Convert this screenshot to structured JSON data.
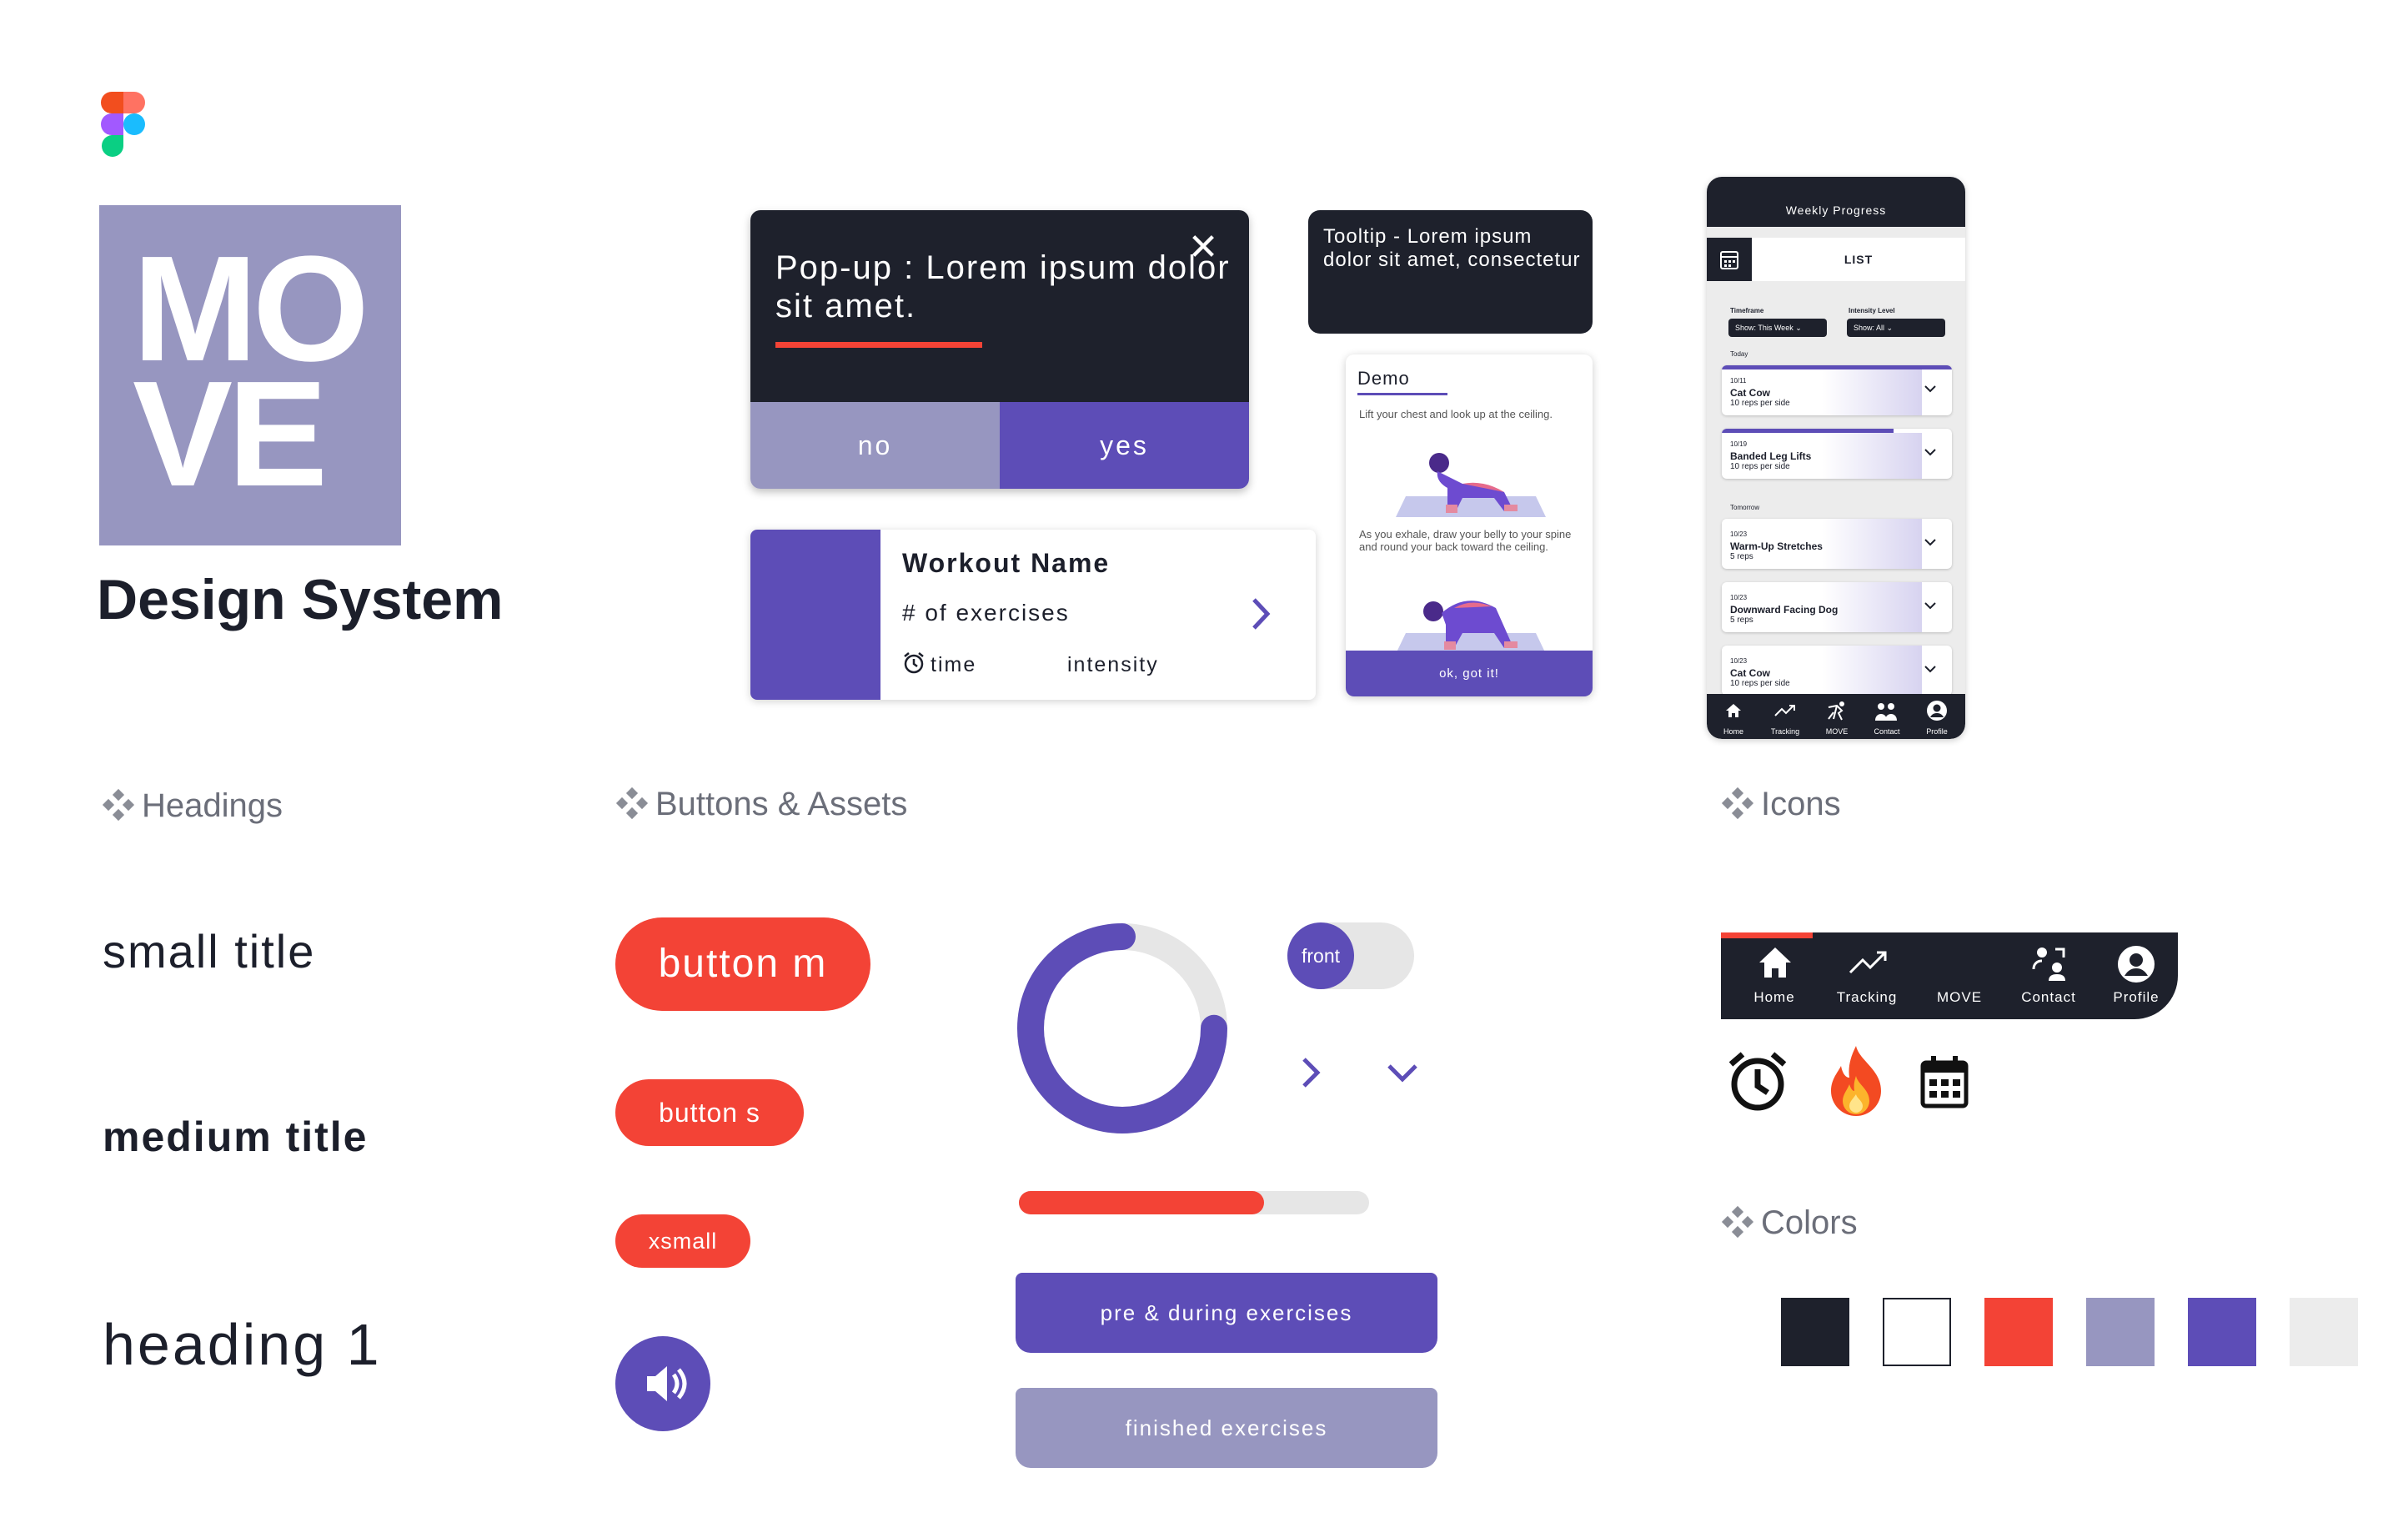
{
  "logo": {
    "line1": "MO",
    "line2": "VE",
    "title": "Design System"
  },
  "sections": {
    "headings": "Headings",
    "buttons": "Buttons & Assets",
    "icons": "Icons",
    "colors": "Colors"
  },
  "headings": {
    "small": "small title",
    "medium": "medium title",
    "h1": "heading 1"
  },
  "popup": {
    "text": "Pop-up : Lorem ipsum dolor sit amet.",
    "no": "no",
    "yes": "yes"
  },
  "tooltip": {
    "text": "Tooltip - Lorem ipsum dolor sit amet, consectetur"
  },
  "workout_card": {
    "name": "Workout Name",
    "exercises": "# of exercises",
    "time": "time",
    "intensity": "intensity"
  },
  "demo_card": {
    "title": "Demo",
    "step1": "Lift your chest and look up at the ceiling.",
    "step2": "As you exhale, draw your belly to your spine and round your back toward the ceiling.",
    "button": "ok, got it!"
  },
  "phone": {
    "header": "Weekly Progress",
    "tab": "LIST",
    "filter1_label": "Timeframe",
    "filter1_value": "Show: This Week",
    "filter2_label": "Intensity Level",
    "filter2_value": "Show: All",
    "today": "Today",
    "tomorrow": "Tomorrow",
    "cards": [
      {
        "date": "10/11",
        "title": "Cat Cow",
        "sub": "10 reps per side"
      },
      {
        "date": "10/19",
        "title": "Banded Leg Lifts",
        "sub": "10 reps per side"
      },
      {
        "date": "10/23",
        "title": "Warm-Up Stretches",
        "sub": "5 reps"
      },
      {
        "date": "10/23",
        "title": "Downward Facing Dog",
        "sub": "5 reps"
      },
      {
        "date": "10/23",
        "title": "Cat Cow",
        "sub": "10 reps per side"
      }
    ],
    "nav": [
      "Home",
      "Tracking",
      "MOVE",
      "Contact",
      "Profile"
    ]
  },
  "buttons": {
    "medium": "button m",
    "small": "button s",
    "xsmall": "xsmall",
    "toggle": "front",
    "pre_during": "pre & during exercises",
    "finished": "finished exercises"
  },
  "progress": {
    "ring_fraction": 0.75,
    "bar_fraction": 0.7
  },
  "icons_bar": {
    "items": [
      "Home",
      "Tracking",
      "MOVE",
      "Contact",
      "Profile"
    ]
  },
  "colors": [
    "#1e212c",
    "#ffffff",
    "#f34336",
    "#9796c0",
    "#5d4db7",
    "#ececec"
  ],
  "icon_names": [
    "alarm-clock-icon",
    "fire-icon",
    "calendar-icon"
  ]
}
